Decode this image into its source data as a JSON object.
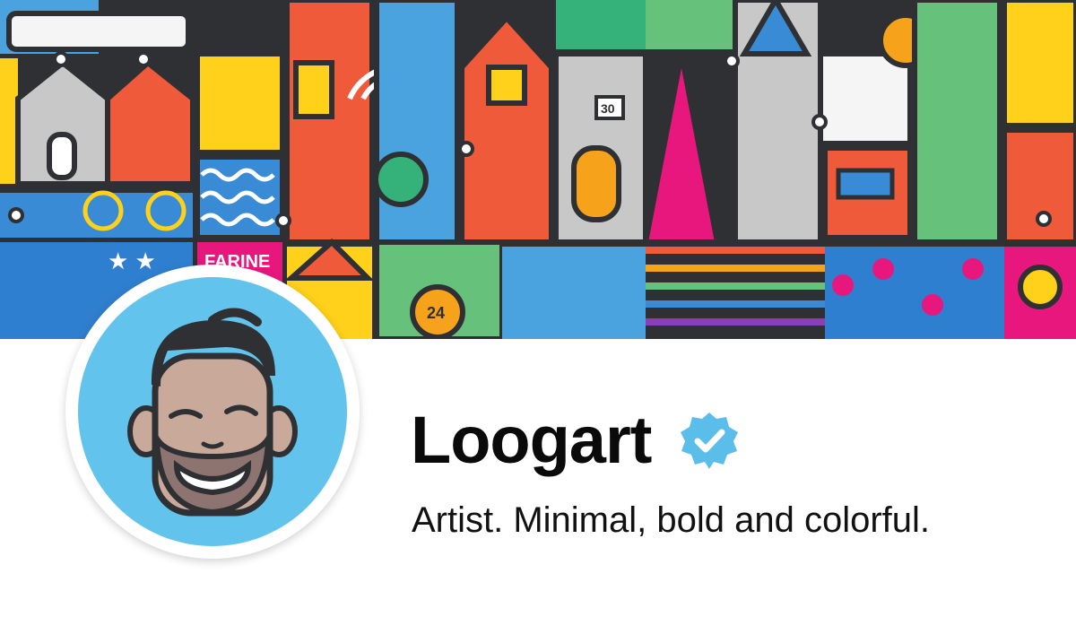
{
  "cover": {
    "signs": {
      "label_30": "30",
      "label_24": "24",
      "farine": "FARINE"
    }
  },
  "profile": {
    "name": "Loogart",
    "bio": "Artist. Minimal, bold and colorful.",
    "verified": true
  },
  "colors": {
    "accent_blue": "#62c3ec",
    "badge_blue": "#5bbdea",
    "name_text": "#0a0a0a"
  },
  "icons": [
    "verified-badge-icon",
    "avatar-illustration",
    "cover-illustration"
  ]
}
